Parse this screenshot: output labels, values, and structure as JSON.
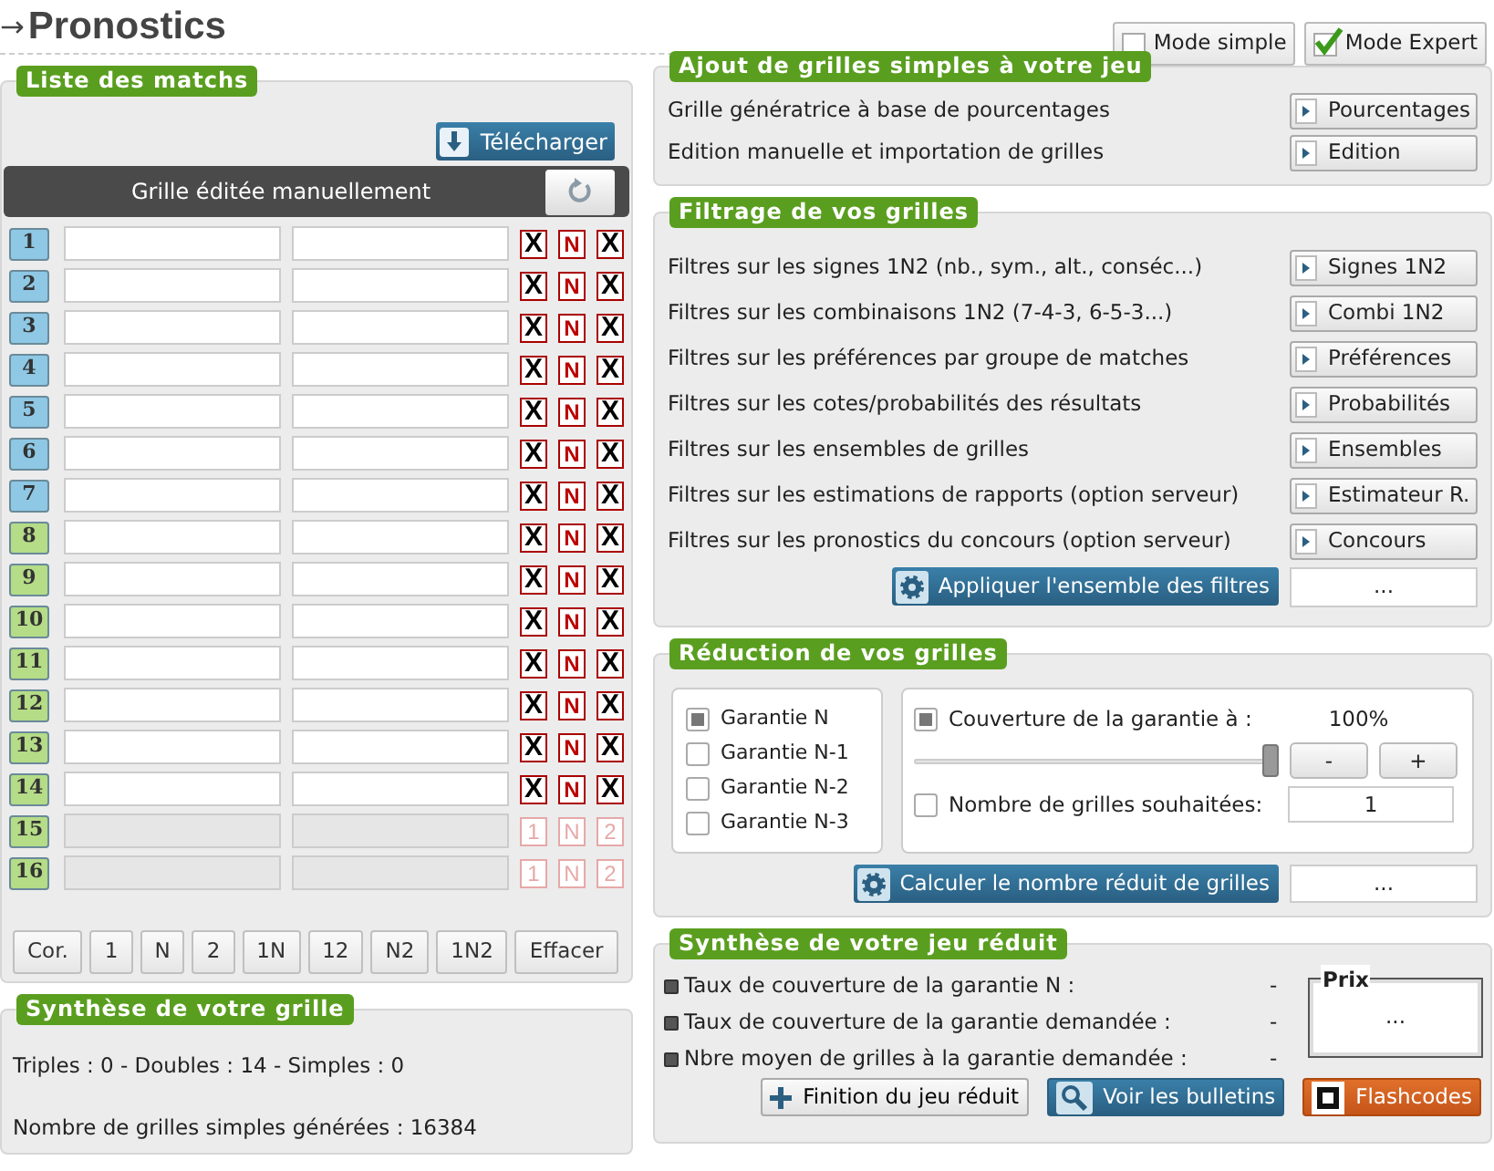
{
  "header": {
    "title": "Pronostics",
    "arrow": "→"
  },
  "modes": [
    {
      "label": "Mode simple",
      "checked": false
    },
    {
      "label": "Mode Expert",
      "checked": true
    }
  ],
  "matches": {
    "title": "Liste des matchs",
    "download": "Télécharger",
    "grid_title": "Grille éditée manuellement",
    "rows": [
      {
        "number": "1",
        "color": "#8ec8e4",
        "disabled": false,
        "signs": [
          {
            "label": "X",
            "selected": true
          },
          {
            "label": "N",
            "selected": false
          },
          {
            "label": "X",
            "selected": true
          }
        ]
      },
      {
        "number": "2",
        "color": "#8ec8e4",
        "disabled": false,
        "signs": [
          {
            "label": "X",
            "selected": true
          },
          {
            "label": "N",
            "selected": false
          },
          {
            "label": "X",
            "selected": true
          }
        ]
      },
      {
        "number": "3",
        "color": "#8ec8e4",
        "disabled": false,
        "signs": [
          {
            "label": "X",
            "selected": true
          },
          {
            "label": "N",
            "selected": false
          },
          {
            "label": "X",
            "selected": true
          }
        ]
      },
      {
        "number": "4",
        "color": "#8ec8e4",
        "disabled": false,
        "signs": [
          {
            "label": "X",
            "selected": true
          },
          {
            "label": "N",
            "selected": false
          },
          {
            "label": "X",
            "selected": true
          }
        ]
      },
      {
        "number": "5",
        "color": "#8ec8e4",
        "disabled": false,
        "signs": [
          {
            "label": "X",
            "selected": true
          },
          {
            "label": "N",
            "selected": false
          },
          {
            "label": "X",
            "selected": true
          }
        ]
      },
      {
        "number": "6",
        "color": "#8ec8e4",
        "disabled": false,
        "signs": [
          {
            "label": "X",
            "selected": true
          },
          {
            "label": "N",
            "selected": false
          },
          {
            "label": "X",
            "selected": true
          }
        ]
      },
      {
        "number": "7",
        "color": "#8ec8e4",
        "disabled": false,
        "signs": [
          {
            "label": "X",
            "selected": true
          },
          {
            "label": "N",
            "selected": false
          },
          {
            "label": "X",
            "selected": true
          }
        ]
      },
      {
        "number": "8",
        "color": "#b5dc86",
        "disabled": false,
        "signs": [
          {
            "label": "X",
            "selected": true
          },
          {
            "label": "N",
            "selected": false
          },
          {
            "label": "X",
            "selected": true
          }
        ]
      },
      {
        "number": "9",
        "color": "#b5dc86",
        "disabled": false,
        "signs": [
          {
            "label": "X",
            "selected": true
          },
          {
            "label": "N",
            "selected": false
          },
          {
            "label": "X",
            "selected": true
          }
        ]
      },
      {
        "number": "10",
        "color": "#b5dc86",
        "disabled": false,
        "signs": [
          {
            "label": "X",
            "selected": true
          },
          {
            "label": "N",
            "selected": false
          },
          {
            "label": "X",
            "selected": true
          }
        ]
      },
      {
        "number": "11",
        "color": "#b5dc86",
        "disabled": false,
        "signs": [
          {
            "label": "X",
            "selected": true
          },
          {
            "label": "N",
            "selected": false
          },
          {
            "label": "X",
            "selected": true
          }
        ]
      },
      {
        "number": "12",
        "color": "#b5dc86",
        "disabled": false,
        "signs": [
          {
            "label": "X",
            "selected": true
          },
          {
            "label": "N",
            "selected": false
          },
          {
            "label": "X",
            "selected": true
          }
        ]
      },
      {
        "number": "13",
        "color": "#b5dc86",
        "disabled": false,
        "signs": [
          {
            "label": "X",
            "selected": true
          },
          {
            "label": "N",
            "selected": false
          },
          {
            "label": "X",
            "selected": true
          }
        ]
      },
      {
        "number": "14",
        "color": "#b5dc86",
        "disabled": false,
        "signs": [
          {
            "label": "X",
            "selected": true
          },
          {
            "label": "N",
            "selected": false
          },
          {
            "label": "X",
            "selected": true
          }
        ]
      },
      {
        "number": "15",
        "color": "#b5dc86",
        "disabled": true,
        "signs": [
          {
            "label": "1",
            "selected": false
          },
          {
            "label": "N",
            "selected": false
          },
          {
            "label": "2",
            "selected": false
          }
        ]
      },
      {
        "number": "16",
        "color": "#b5dc86",
        "disabled": true,
        "signs": [
          {
            "label": "1",
            "selected": false
          },
          {
            "label": "N",
            "selected": false
          },
          {
            "label": "2",
            "selected": false
          }
        ]
      }
    ],
    "buttons": [
      "Cor.",
      "1",
      "N",
      "2",
      "1N",
      "12",
      "N2",
      "1N2",
      "Effacer"
    ]
  },
  "grid_summary": {
    "title": "Synthèse de votre grille",
    "lines": [
      "Triples : 0 - Doubles : 14 - Simples : 0",
      "Nombre de grilles simples générées : 16384"
    ]
  },
  "add_grids": {
    "title": "Ajout de grilles simples à votre jeu",
    "items": [
      {
        "label": "Grille génératrice à base de pourcentages",
        "button": "Pourcentages"
      },
      {
        "label": "Edition manuelle et importation de grilles",
        "button": "Edition"
      }
    ]
  },
  "filters": {
    "title": "Filtrage de vos grilles",
    "items": [
      {
        "label": "Filtres sur les signes 1N2 (nb., sym., alt., conséc...)",
        "button": "Signes 1N2"
      },
      {
        "label": "Filtres sur les combinaisons 1N2 (7-4-3, 6-5-3...)",
        "button": "Combi 1N2"
      },
      {
        "label": "Filtres sur les préférences par groupe de matches",
        "button": "Préférences"
      },
      {
        "label": "Filtres sur les cotes/probabilités des résultats",
        "button": "Probabilités"
      },
      {
        "label": "Filtres sur les ensembles de grilles",
        "button": "Ensembles"
      },
      {
        "label": "Filtres sur les estimations de rapports (option serveur)",
        "button": "Estimateur R."
      },
      {
        "label": "Filtres sur les pronostics du concours (option serveur)",
        "button": "Concours"
      }
    ],
    "apply": "Appliquer l'ensemble des filtres",
    "result": "..."
  },
  "reduction": {
    "title": "Réduction de vos grilles",
    "guarantees": [
      {
        "label": "Garantie N",
        "checked": true
      },
      {
        "label": "Garantie N-1",
        "checked": false
      },
      {
        "label": "Garantie N-2",
        "checked": false
      },
      {
        "label": "Garantie N-3",
        "checked": false
      }
    ],
    "coverage": {
      "label": "Couverture de la garantie à :",
      "checked": true,
      "value": "100%",
      "level": 1,
      "minus": "-",
      "plus": "+"
    },
    "count": {
      "label": "Nombre de grilles souhaitées:",
      "checked": false,
      "value": "1"
    },
    "compute": "Calculer le nombre réduit de grilles",
    "result": "..."
  },
  "reduced_summary": {
    "title": "Synthèse de votre jeu réduit",
    "lines": [
      {
        "label": "Taux de couverture de la garantie N :",
        "value": "-"
      },
      {
        "label": "Taux de couverture de la garantie demandée :",
        "value": "-"
      },
      {
        "label": "Nbre moyen de grilles à la garantie demandée :",
        "value": "-"
      }
    ],
    "price": {
      "legend": "Prix",
      "value": "..."
    },
    "buttons": [
      {
        "label": "Finition du jeu réduit",
        "kind": "plus"
      },
      {
        "label": "Voir les bulletins",
        "kind": "search"
      },
      {
        "label": "Flashcodes",
        "kind": "code"
      }
    ]
  }
}
